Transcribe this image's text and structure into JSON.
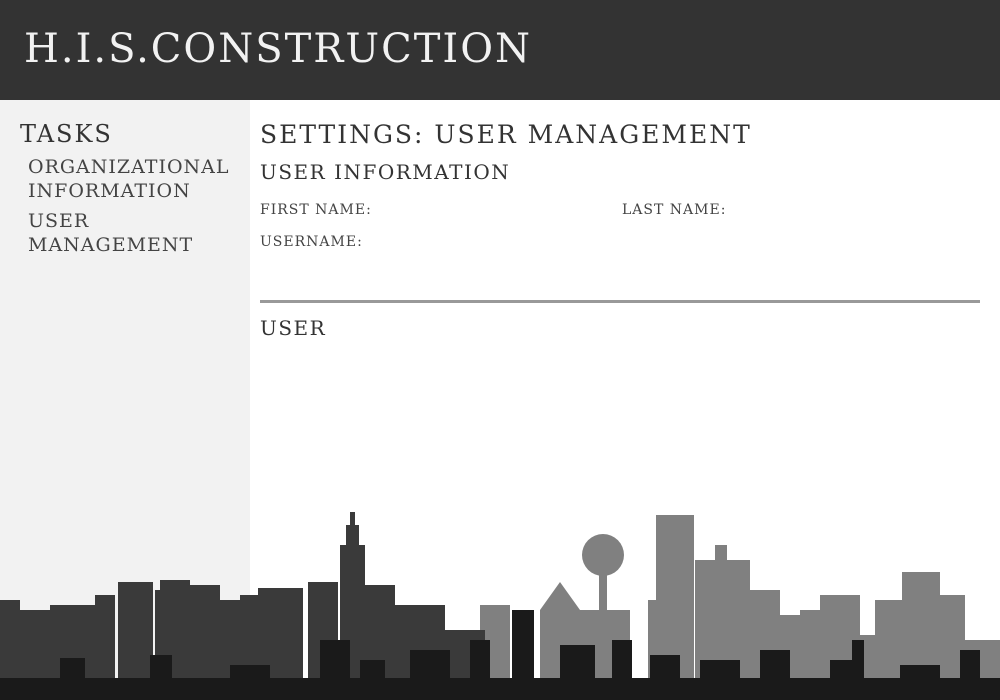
{
  "header": {
    "brand": "H.I.S.CONSTRUCTION"
  },
  "sidebar": {
    "title": "TASKS",
    "items": [
      {
        "label_line1": "ORGANIZATIONAL",
        "label_line2": "INFORMATION"
      },
      {
        "label_line1": "USER",
        "label_line2": "MANAGEMENT"
      }
    ]
  },
  "main": {
    "page_title": "SETTINGS: USER MANAGEMENT",
    "user_info": {
      "title": "USER INFORMATION",
      "first_name_label": "FIRST NAME:",
      "last_name_label": "LAST NAME:",
      "username_label": "USERNAME:"
    },
    "user_section_title": "USER"
  },
  "colors": {
    "header_bg": "#333333",
    "sidebar_bg": "#f2f2f2",
    "divider": "#999999",
    "skyline_front": "#1a1a1a",
    "skyline_mid": "#3a3a3a",
    "skyline_back": "#808080"
  }
}
